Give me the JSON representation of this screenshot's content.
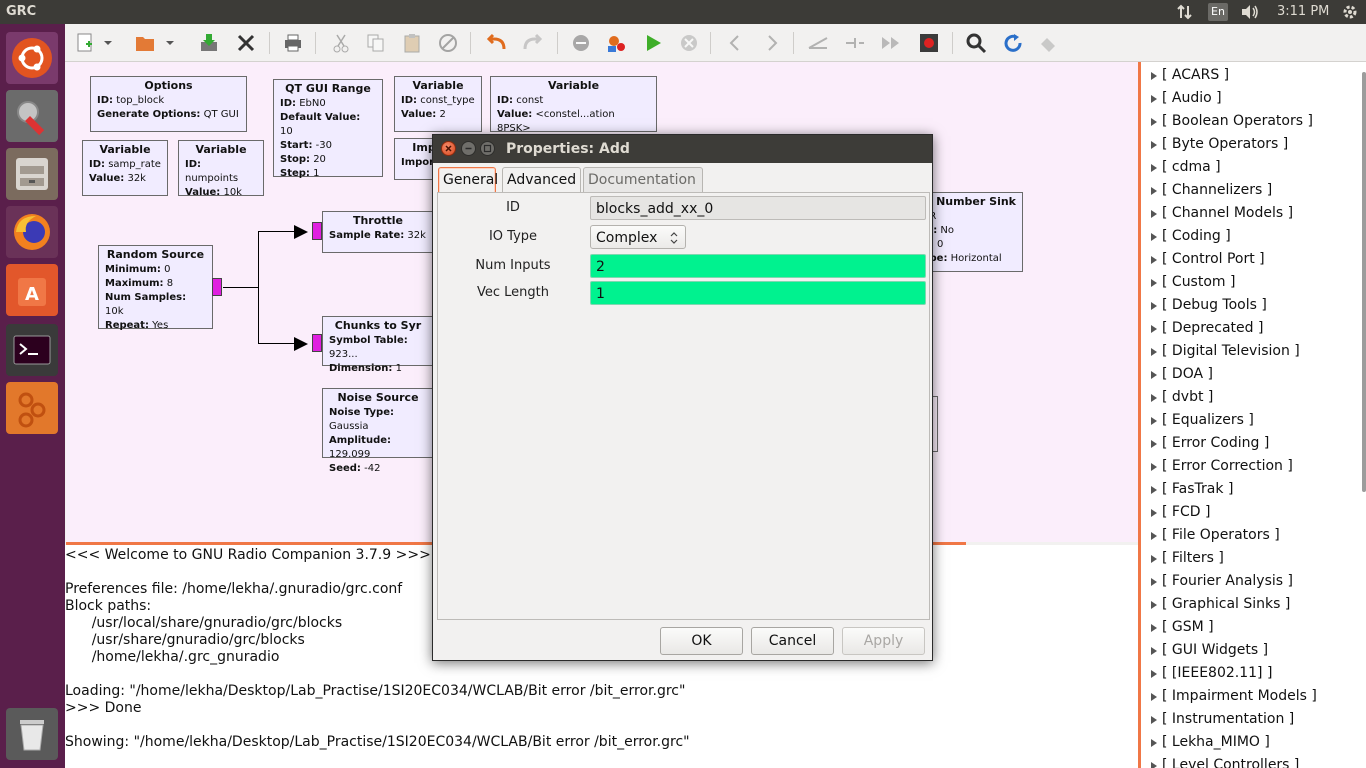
{
  "topbar": {
    "app_title": "GRC",
    "keyboard_layout": "En",
    "clock": "3:11 PM"
  },
  "launcher": {
    "items": [
      "Ubuntu Dash",
      "System Settings",
      "Files",
      "Firefox Web Browser",
      "Ubuntu Software",
      "Terminal",
      "GNU Radio Companion",
      "Trash"
    ]
  },
  "toolbar": {
    "buttons": [
      "new",
      "open",
      "save",
      "close",
      "print",
      "cut",
      "copy",
      "paste",
      "delete",
      "undo",
      "redo",
      "disable",
      "generate",
      "execute",
      "kill",
      "rotate-ccw",
      "rotate-cw",
      "enable",
      "bypass",
      "find",
      "reload",
      "find-blocks"
    ]
  },
  "canvas": {
    "blocks": [
      {
        "title": "Options",
        "lines": [
          [
            "ID:",
            " top_block"
          ],
          [
            "Generate Options:",
            " QT GUI"
          ]
        ]
      },
      {
        "title": "QT GUI Range",
        "lines": [
          [
            "ID:",
            " EbN0"
          ],
          [
            "Default Value:",
            " 10"
          ],
          [
            "Start:",
            " -30"
          ],
          [
            "Stop:",
            " 20"
          ],
          [
            "Step:",
            " 1"
          ]
        ]
      },
      {
        "title": "Variable",
        "lines": [
          [
            "ID:",
            " const_type"
          ],
          [
            "Value:",
            " 2"
          ]
        ]
      },
      {
        "title": "Variable",
        "lines": [
          [
            "ID:",
            " const"
          ],
          [
            "Value:",
            " <constel...ation 8PSK>"
          ]
        ]
      },
      {
        "title": "Variable",
        "lines": [
          [
            "ID:",
            " samp_rate"
          ],
          [
            "Value:",
            " 32k"
          ]
        ]
      },
      {
        "title": "Variable",
        "lines": [
          [
            "ID:",
            " numpoints"
          ],
          [
            "Value:",
            " 10k"
          ]
        ]
      },
      {
        "title": "Random Source",
        "lines": [
          [
            "Minimum:",
            " 0"
          ],
          [
            "Maximum:",
            " 8"
          ],
          [
            "Num Samples:",
            " 10k"
          ],
          [
            "Repeat:",
            " Yes"
          ]
        ]
      },
      {
        "title": "Throttle",
        "lines": [
          [
            "Sample Rate:",
            " 32k"
          ]
        ]
      },
      {
        "title": "Chunks to Syr",
        "lines": [
          [
            "Symbol Table:",
            " 923..."
          ],
          [
            "Dimension:",
            " 1"
          ]
        ]
      },
      {
        "title": "Noise Source",
        "lines": [
          [
            "Noise Type:",
            " Gaussia"
          ],
          [
            "Amplitude:",
            " 129.099"
          ],
          [
            "Seed:",
            " -42"
          ]
        ]
      },
      {
        "title": "Number Sink",
        "lines": [
          [
            "",
            "ER"
          ],
          [
            "le:",
            " No"
          ],
          [
            "e:",
            " 0"
          ],
          [
            "ype:",
            " Horizontal"
          ]
        ]
      },
      {
        "title": "Imp",
        "lines": [
          [
            "Impor",
            ""
          ]
        ]
      }
    ]
  },
  "console": {
    "lines": [
      "<<< Welcome to GNU Radio Companion 3.7.9 >>>",
      "",
      "Preferences file: /home/lekha/.gnuradio/grc.conf",
      "Block paths:",
      "      /usr/local/share/gnuradio/grc/blocks",
      "      /usr/share/gnuradio/grc/blocks",
      "      /home/lekha/.grc_gnuradio",
      "",
      "Loading: \"/home/lekha/Desktop/Lab_Practise/1SI20EC034/WCLAB/Bit error /bit_error.grc\"",
      ">>> Done",
      "",
      "Showing: \"/home/lekha/Desktop/Lab_Practise/1SI20EC034/WCLAB/Bit error /bit_error.grc\""
    ]
  },
  "block_tree": {
    "categories": [
      "[ ACARS ]",
      "[ Audio ]",
      "[ Boolean Operators ]",
      "[ Byte Operators ]",
      "[ cdma ]",
      "[ Channelizers ]",
      "[ Channel Models ]",
      "[ Coding ]",
      "[ Control Port ]",
      "[ Custom ]",
      "[ Debug Tools ]",
      "[ Deprecated ]",
      "[ Digital Television ]",
      "[ DOA ]",
      "[ dvbt ]",
      "[ Equalizers ]",
      "[ Error Coding ]",
      "[ Error Correction ]",
      "[ FasTrak ]",
      "[ FCD ]",
      "[ File Operators ]",
      "[ Filters ]",
      "[ Fourier Analysis ]",
      "[ Graphical Sinks ]",
      "[ GSM ]",
      "[ GUI Widgets ]",
      "[ [IEEE802.11] ]",
      "[ Impairment Models ]",
      "[ Instrumentation ]",
      "[ Lekha_MIMO ]",
      "[ Level Controllers ]"
    ]
  },
  "dialog": {
    "title": "Properties: Add",
    "tabs": [
      "General",
      "Advanced",
      "Documentation"
    ],
    "active_tab": "General",
    "params": [
      {
        "label": "ID",
        "value": "blocks_add_xx_0"
      },
      {
        "label": "IO Type",
        "value": "Complex"
      },
      {
        "label": "Num Inputs",
        "value": "2"
      },
      {
        "label": "Vec Length",
        "value": "1"
      }
    ],
    "buttons": {
      "ok": "OK",
      "cancel": "Cancel",
      "apply": "Apply"
    },
    "field_highlight": "#00f28f"
  }
}
